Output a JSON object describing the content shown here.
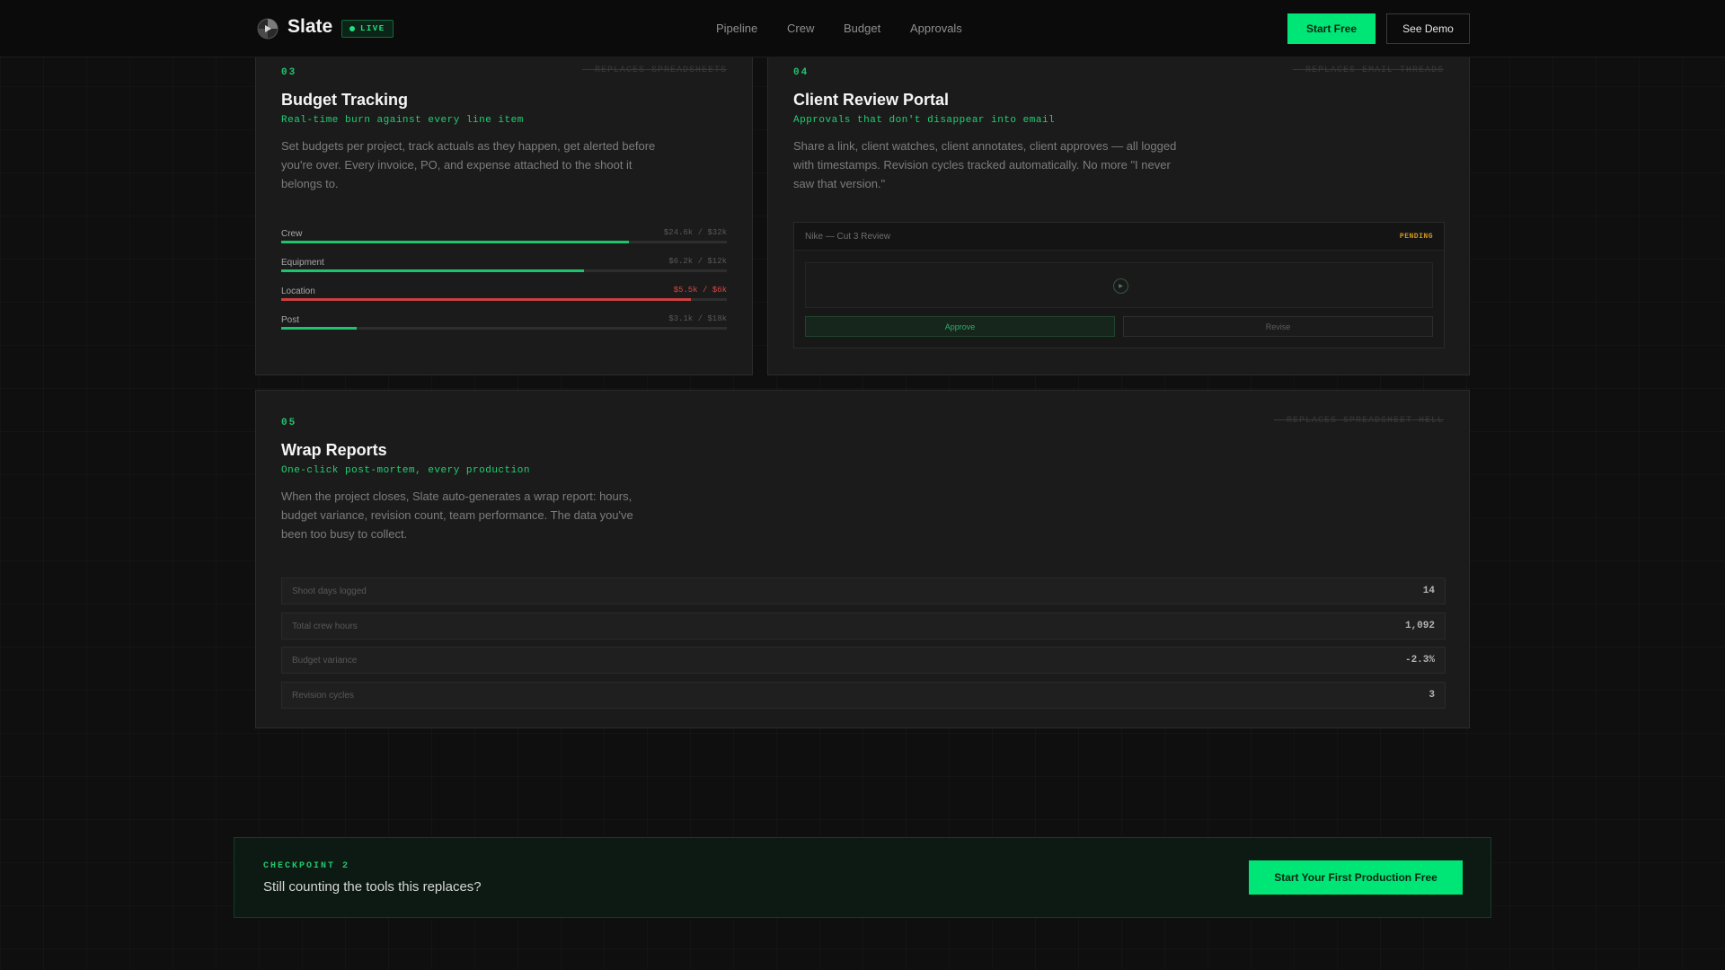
{
  "header": {
    "brand": "Slate",
    "live_label": "LIVE",
    "nav": [
      {
        "label": "Pipeline"
      },
      {
        "label": "Crew"
      },
      {
        "label": "Budget"
      },
      {
        "label": "Approvals"
      }
    ],
    "start_free": "Start Free",
    "see_demo": "See Demo"
  },
  "budget_card": {
    "number": "03",
    "struck_text": "— REPLACES SPREADSHEETS",
    "title": "Budget Tracking",
    "subtitle": "Real-time burn against every line item",
    "description": "Set budgets per project, track actuals as they happen, get alerted before you're over. Every invoice, PO, and expense attached to the shoot it belongs to.",
    "bars": [
      {
        "label": "Crew",
        "value": "$24.6k / $32k",
        "fill_pct": 78,
        "status": "ok"
      },
      {
        "label": "Equipment",
        "value": "$6.2k / $12k",
        "fill_pct": 68,
        "status": "ok"
      },
      {
        "label": "Location",
        "value": "$5.5k / $6k",
        "fill_pct": 92,
        "status": "alert"
      },
      {
        "label": "Post",
        "value": "$3.1k / $18k",
        "fill_pct": 17,
        "status": "ok"
      }
    ],
    "colors": {
      "ok": "#1ec46b",
      "alert": "#cc4040"
    }
  },
  "review_card": {
    "number": "04",
    "struck_text": "— REPLACES EMAIL THREADS",
    "title": "Client Review Portal",
    "subtitle": "Approvals that don't disappear into email",
    "description": "Share a link, client watches, client annotates, client approves — all logged with timestamps. Revision cycles tracked automatically. No more \"I never saw that version.\"",
    "review": {
      "title": "Nike — Cut 3 Review",
      "status": "PENDING",
      "play_icon": "play-icon",
      "approve_label": "Approve",
      "revise_label": "Revise"
    }
  },
  "wrap_card": {
    "number": "05",
    "struck_text": "— REPLACES SPREADSHEET HELL",
    "title": "Wrap Reports",
    "subtitle": "One-click post-mortem, every production",
    "description": "When the project closes, Slate auto-generates a wrap report: hours, budget variance, revision count, team performance. The data you've been too busy to collect.",
    "stats": [
      {
        "label": "Shoot days logged",
        "value": "14"
      },
      {
        "label": "Total crew hours",
        "value": "1,092"
      },
      {
        "label": "Budget variance",
        "value": "-2.3%"
      },
      {
        "label": "Revision cycles",
        "value": "3"
      }
    ]
  },
  "checkpoint": {
    "label": "CHECKPOINT 2",
    "text": "Still counting the tools this replaces?",
    "button": "Start Your First Production Free"
  },
  "colors": {
    "accent": "#00e676",
    "alert": "#cc4040",
    "pending": "#d39a1a",
    "background": "#0f0f0f",
    "card": "#1b1b1b"
  }
}
